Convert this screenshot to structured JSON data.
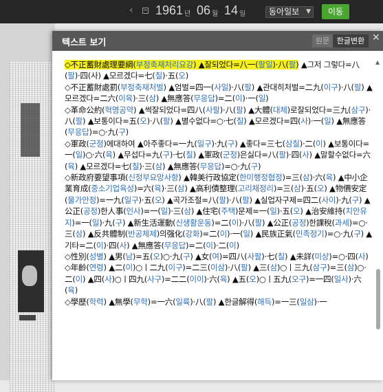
{
  "topbar": {
    "year": "1961",
    "year_unit": "년",
    "month": "06",
    "month_unit": "월",
    "day": "14",
    "day_unit": "일",
    "newspaper": "동아일보",
    "go_button": "이동"
  },
  "modal": {
    "title": "텍스트 보기",
    "tab_original": "원문",
    "tab_converted": "한글변환"
  },
  "colors": {
    "highlight": "#f4ef1d",
    "reading": "#2f6fb5",
    "go_button": "#4aa531",
    "header": "#575757"
  },
  "paragraphs": [
    [
      [
        "◇不正蓄財處理要綱(",
        "hl"
      ],
      [
        "부정축재처리요강",
        "hlr"
      ],
      [
        ")",
        "hl"
      ],
      [
        " ▲잘되었다=八一(",
        "hl"
      ],
      [
        "팔일",
        "hlr"
      ],
      [
        ")·八(",
        "hl"
      ],
      [
        "팔",
        "hlr"
      ],
      [
        ")",
        "hl"
      ],
      [
        " ▲그저 그렇다=八(",
        ""
      ],
      [
        "팔",
        "r"
      ],
      [
        ")·四(",
        ""
      ],
      [
        "사",
        ""
      ],
      [
        ") ▲모르겠다=七(",
        ""
      ],
      [
        "칠",
        "r"
      ],
      [
        ")·五(",
        ""
      ],
      [
        "오",
        "r"
      ],
      [
        ")",
        ""
      ]
    ],
    [
      [
        "◇不正蓄財處罰(",
        ""
      ],
      [
        "부정축재처벌",
        "r"
      ],
      [
        ") ▲엄벌=四一(",
        ""
      ],
      [
        "사일",
        "r"
      ],
      [
        ")·八(",
        ""
      ],
      [
        "팔",
        "r"
      ],
      [
        ") ▲관대히처벌=二九(",
        ""
      ],
      [
        "이구",
        "r"
      ],
      [
        ")·八(",
        ""
      ],
      [
        "팔",
        "r"
      ],
      [
        ") ▲모르겠다=二六(",
        ""
      ],
      [
        "이육",
        "r"
      ],
      [
        ")·三(",
        ""
      ],
      [
        "삼",
        "r"
      ],
      [
        ") ▲無應答(",
        ""
      ],
      [
        "무응답",
        "r"
      ],
      [
        ")=二(",
        ""
      ],
      [
        "이",
        "r"
      ],
      [
        ")·一(",
        ""
      ],
      [
        "일",
        "r"
      ],
      [
        ")",
        ""
      ]
    ],
    [
      [
        "◇革命公約(",
        ""
      ],
      [
        "혁명공약",
        "r"
      ],
      [
        ") ▲썩잘되었다=四八(",
        ""
      ],
      [
        "사팔",
        "r"
      ],
      [
        ")·八(",
        ""
      ],
      [
        "팔",
        "r"
      ],
      [
        ") ▲大體(",
        ""
      ],
      [
        "대체",
        "r"
      ],
      [
        ")로잘되었다=三九(",
        ""
      ],
      [
        "삼구",
        "r"
      ],
      [
        ")·八(",
        ""
      ],
      [
        "팔",
        "r"
      ],
      [
        ") ▲보통이다=五(",
        ""
      ],
      [
        "오",
        "r"
      ],
      [
        ")·八(",
        ""
      ],
      [
        "팔",
        "r"
      ],
      [
        ") ▲별수없다=○·七(",
        ""
      ],
      [
        "칠",
        "r"
      ],
      [
        ") ▲모르겠다=四(",
        ""
      ],
      [
        "사",
        "r"
      ],
      [
        ")·一(",
        ""
      ],
      [
        "일",
        "r"
      ],
      [
        ") ▲無應答(",
        ""
      ],
      [
        "무응답",
        "r"
      ],
      [
        ")=○·九(",
        ""
      ],
      [
        "구",
        "r"
      ],
      [
        ")",
        ""
      ]
    ],
    [
      [
        "◇軍政(",
        ""
      ],
      [
        "군정",
        "r"
      ],
      [
        ")에대하여 ▲아주좋다=一九(",
        ""
      ],
      [
        "일구",
        "r"
      ],
      [
        ")·九(",
        ""
      ],
      [
        "구",
        "r"
      ],
      [
        ") ▲좋다=三七(",
        ""
      ],
      [
        "삼칠",
        "r"
      ],
      [
        ")·二(",
        ""
      ],
      [
        "이",
        "r"
      ],
      [
        ") ▲보통이다=一(",
        ""
      ],
      [
        "일",
        "r"
      ],
      [
        ")○·六(",
        ""
      ],
      [
        "육",
        "r"
      ],
      [
        ") ▲무섭다=九(",
        ""
      ],
      [
        "구",
        "r"
      ],
      [
        ")·七(",
        ""
      ],
      [
        "칠",
        "r"
      ],
      [
        ") ▲軍政(",
        ""
      ],
      [
        "군정",
        "r"
      ],
      [
        ")은싫다=八(",
        ""
      ],
      [
        "팔",
        "r"
      ],
      [
        ")·四(",
        ""
      ],
      [
        "사",
        "r"
      ],
      [
        ") ▲말할수없다=六(",
        ""
      ],
      [
        "육",
        "r"
      ],
      [
        ") ▲모르겠다=七(",
        ""
      ],
      [
        "칠",
        "r"
      ],
      [
        ")·三(",
        ""
      ],
      [
        "삼",
        "r"
      ],
      [
        ") ▲無應答(",
        ""
      ],
      [
        "무응답",
        "r"
      ],
      [
        ")=○·九(",
        ""
      ],
      [
        "구",
        "r"
      ],
      [
        ")",
        ""
      ]
    ],
    [
      [
        "◇新政府要望事項(",
        ""
      ],
      [
        "신정부요망사항",
        "r"
      ],
      [
        ") ▲韓美行政協定(",
        ""
      ],
      [
        "한미행정협정",
        "r"
      ],
      [
        ")=三(",
        ""
      ],
      [
        "삼",
        "r"
      ],
      [
        ")·六(",
        ""
      ],
      [
        "육",
        "r"
      ],
      [
        ") ▲中小企業育成(",
        ""
      ],
      [
        "중소기업육성",
        "r"
      ],
      [
        ")=六(",
        ""
      ],
      [
        "육",
        "r"
      ],
      [
        ")·三(",
        ""
      ],
      [
        "삼",
        "r"
      ],
      [
        ") ▲高利債整理(",
        ""
      ],
      [
        "고리채정리",
        "r"
      ],
      [
        ")=三(",
        ""
      ],
      [
        "삼",
        "r"
      ],
      [
        ")·五(",
        ""
      ],
      [
        "오",
        "r"
      ],
      [
        ") ▲物價安定(",
        ""
      ],
      [
        "물가안정",
        "r"
      ],
      [
        ")=一九(",
        ""
      ],
      [
        "일구",
        "r"
      ],
      [
        ")·五(",
        ""
      ],
      [
        "오",
        "r"
      ],
      [
        ") ▲곡가조절=八(",
        ""
      ],
      [
        "팔",
        "r"
      ],
      [
        ")·八(",
        ""
      ],
      [
        "팔",
        "r"
      ],
      [
        ") ▲실업자구제=四二(",
        ""
      ],
      [
        "사이",
        "r"
      ],
      [
        ")·九(",
        ""
      ],
      [
        "구",
        "r"
      ],
      [
        ") ▲公正(",
        ""
      ],
      [
        "공정",
        "r"
      ],
      [
        ")한人事(",
        ""
      ],
      [
        "인사",
        "r"
      ],
      [
        ")=一(",
        ""
      ],
      [
        "일",
        "r"
      ],
      [
        ")·三(",
        ""
      ],
      [
        "삼",
        "r"
      ],
      [
        ") ▲住宅(",
        ""
      ],
      [
        "주택",
        "r"
      ],
      [
        ")문제=一(",
        ""
      ],
      [
        "일",
        "r"
      ],
      [
        ")·五(",
        ""
      ],
      [
        "오",
        "r"
      ],
      [
        ") ▲治安維持(",
        ""
      ],
      [
        "치안유지",
        "r"
      ],
      [
        ")=一(",
        ""
      ],
      [
        "일",
        "r"
      ],
      [
        ")·九(",
        ""
      ],
      [
        "구",
        "r"
      ],
      [
        ") ▲新生活運動(",
        ""
      ],
      [
        "신생활운동",
        "r"
      ],
      [
        ")=二(",
        ""
      ],
      [
        "이",
        "r"
      ],
      [
        ")·八(",
        ""
      ],
      [
        "팔",
        "r"
      ],
      [
        ") ▲公正(",
        ""
      ],
      [
        "공정",
        "r"
      ],
      [
        ")한課稅(",
        ""
      ],
      [
        "과세",
        "r"
      ],
      [
        ")=○·三(",
        ""
      ],
      [
        "삼",
        "r"
      ],
      [
        ") ▲反共體制(",
        ""
      ],
      [
        "반공체제",
        "r"
      ],
      [
        ")의强化(",
        ""
      ],
      [
        "강화",
        "r"
      ],
      [
        ")=二(",
        ""
      ],
      [
        "이",
        "r"
      ],
      [
        ")·一(",
        ""
      ],
      [
        "일",
        "r"
      ],
      [
        ") ▲民族正氣(",
        ""
      ],
      [
        "민족정기",
        "r"
      ],
      [
        ")=○·九(",
        ""
      ],
      [
        "구",
        "r"
      ],
      [
        ") ▲기타=二(",
        ""
      ],
      [
        "이",
        "r"
      ],
      [
        ")·四(",
        ""
      ],
      [
        "사",
        "r"
      ],
      [
        ") ▲無應答(",
        ""
      ],
      [
        "무응답",
        "r"
      ],
      [
        ")=二(",
        ""
      ],
      [
        "이",
        "r"
      ],
      [
        ")·二(",
        ""
      ],
      [
        "이",
        "r"
      ],
      [
        ")",
        ""
      ]
    ],
    [
      [
        "◇性別(",
        ""
      ],
      [
        "성별",
        "r"
      ],
      [
        ") ▲男(",
        ""
      ],
      [
        "남",
        "r"
      ],
      [
        ")=五(",
        ""
      ],
      [
        "오",
        "r"
      ],
      [
        ")○·九(",
        ""
      ],
      [
        "구",
        "r"
      ],
      [
        ") ▲女(",
        ""
      ],
      [
        "여",
        "r"
      ],
      [
        ")=四八(",
        ""
      ],
      [
        "사팔",
        "r"
      ],
      [
        ")·七(",
        ""
      ],
      [
        "칠",
        "r"
      ],
      [
        ") ▲未詳(",
        ""
      ],
      [
        "미상",
        "r"
      ],
      [
        ")=○·四(",
        ""
      ],
      [
        "사",
        "r"
      ],
      [
        ")",
        ""
      ]
    ],
    [
      [
        "◇年齡(",
        ""
      ],
      [
        "연령",
        "r"
      ],
      [
        ") ▲二(",
        ""
      ],
      [
        "이",
        "r"
      ],
      [
        ")○ㅣ二九(",
        ""
      ],
      [
        "이구",
        "r"
      ],
      [
        ")=二三(",
        ""
      ],
      [
        "이삼",
        "r"
      ],
      [
        ")·八(",
        ""
      ],
      [
        "팔",
        "r"
      ],
      [
        ") ▲三(",
        ""
      ],
      [
        "삼",
        "r"
      ],
      [
        ")○ㅣ三九(",
        ""
      ],
      [
        "삼구",
        "r"
      ],
      [
        ")=三(",
        ""
      ],
      [
        "삼",
        "r"
      ],
      [
        ")○·二(",
        ""
      ],
      [
        "이",
        "r"
      ],
      [
        ") ▲四(",
        ""
      ],
      [
        "사",
        "r"
      ],
      [
        ")○ㅣ四九(",
        ""
      ],
      [
        "사구",
        "r"
      ],
      [
        ")=二二(",
        ""
      ],
      [
        "이이",
        "r"
      ],
      [
        ")·六(",
        ""
      ],
      [
        "육",
        "r"
      ],
      [
        ") ▲五(",
        ""
      ],
      [
        "오",
        "r"
      ],
      [
        ")○ㅣ五九(",
        ""
      ],
      [
        "오구",
        "r"
      ],
      [
        ")=一四(",
        ""
      ],
      [
        "일사",
        "r"
      ],
      [
        ")·六(",
        ""
      ],
      [
        "육",
        "r"
      ],
      [
        ")",
        ""
      ]
    ],
    [
      [
        "◇學歷(",
        ""
      ],
      [
        "학력",
        "r"
      ],
      [
        ") ▲無學(",
        ""
      ],
      [
        "무학",
        "r"
      ],
      [
        ")=一六(",
        ""
      ],
      [
        "일륙",
        "r"
      ],
      [
        ")·八(",
        ""
      ],
      [
        "팔",
        "r"
      ],
      [
        ") ▲한글解得(",
        ""
      ],
      [
        "해득",
        "r"
      ],
      [
        ")=一三(",
        ""
      ],
      [
        "일삼",
        "r"
      ],
      [
        ")·一",
        ""
      ]
    ]
  ]
}
